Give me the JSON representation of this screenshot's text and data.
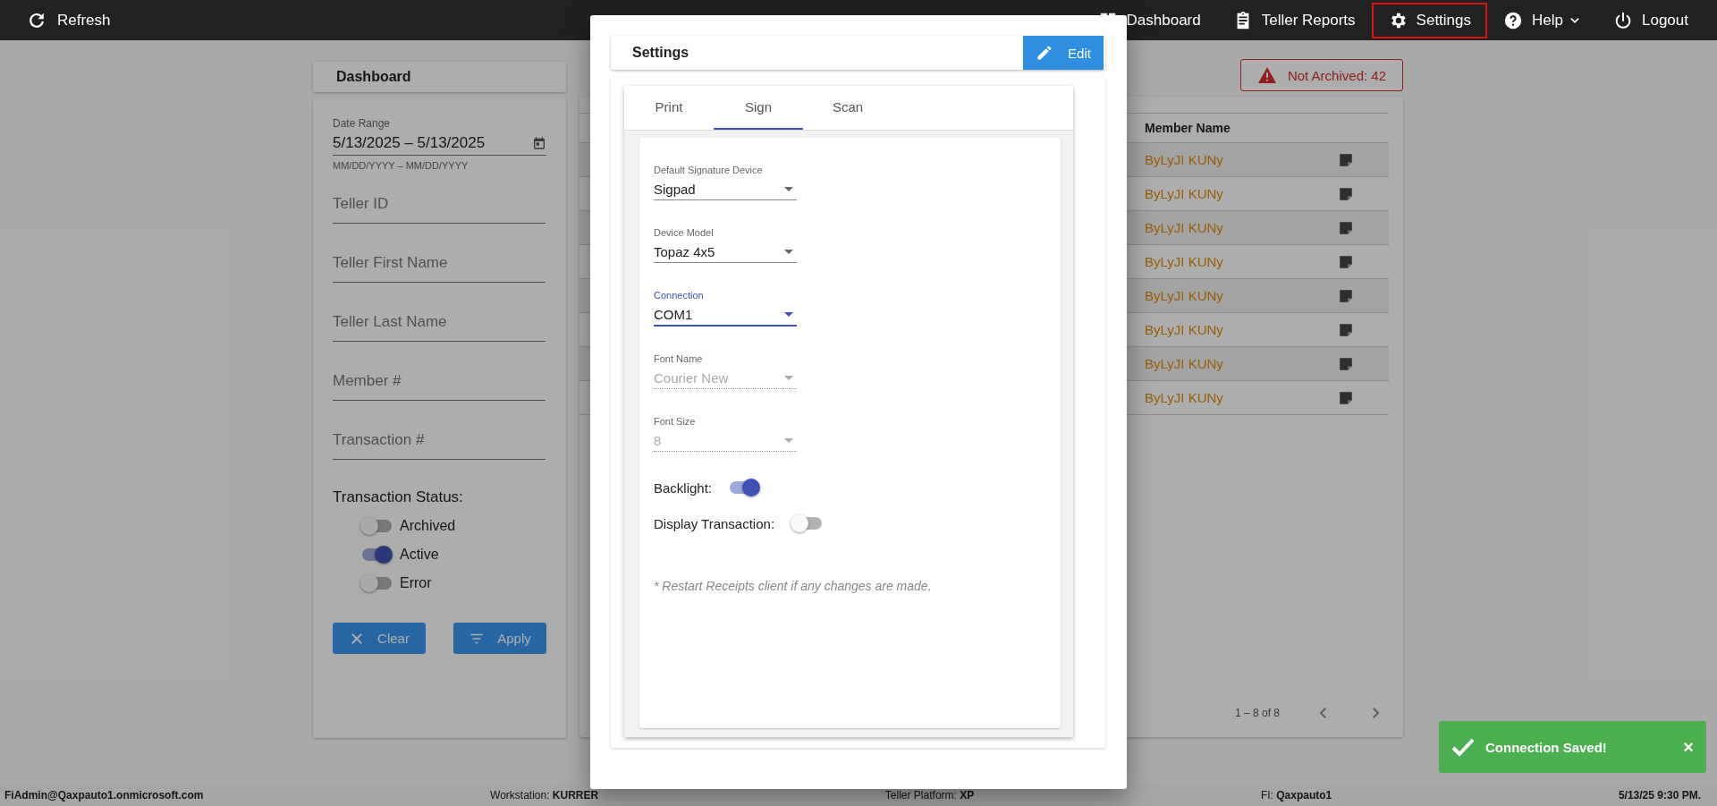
{
  "topbar": {
    "refresh": "Refresh",
    "nav": [
      {
        "kind": "dashboard",
        "label": "Dashboard",
        "selected": false
      },
      {
        "kind": "reports",
        "label": "Teller Reports",
        "selected": false
      },
      {
        "kind": "settings",
        "label": "Settings",
        "selected": true
      },
      {
        "kind": "help",
        "label": "Help",
        "selected": false
      },
      {
        "kind": "logout",
        "label": "Logout",
        "selected": false
      }
    ]
  },
  "dashboard": {
    "title": "Dashboard",
    "date_range": {
      "label": "Date Range",
      "value": "5/13/2025 – 5/13/2025",
      "hint": "MM/DD/YYYY – MM/DD/YYYY"
    },
    "fields": [
      {
        "placeholder": "Teller ID"
      },
      {
        "placeholder": "Teller First Name"
      },
      {
        "placeholder": "Teller Last Name"
      },
      {
        "placeholder": "Member #"
      },
      {
        "placeholder": "Transaction #"
      }
    ],
    "status_title": "Transaction Status:",
    "status_toggles": [
      {
        "label": "Archived",
        "on": false
      },
      {
        "label": "Active",
        "on": true
      },
      {
        "label": "Error",
        "on": false
      }
    ],
    "buttons": [
      {
        "kind": "clear",
        "label": "Clear"
      },
      {
        "kind": "apply",
        "label": "Apply"
      }
    ]
  },
  "not_archived": "Not Archived: 42",
  "table": {
    "columns": [
      "Member Name"
    ],
    "rows": [
      {
        "member_name": "ByLyJI KUNy"
      },
      {
        "member_name": "ByLyJI KUNy"
      },
      {
        "member_name": "ByLyJI KUNy"
      },
      {
        "member_name": "ByLyJI KUNy"
      },
      {
        "member_name": "ByLyJI KUNy"
      },
      {
        "member_name": "ByLyJI KUNy"
      },
      {
        "member_name": "ByLyJI KUNy"
      },
      {
        "member_name": "ByLyJI KUNy"
      }
    ],
    "pagination": "1 – 8 of 8"
  },
  "settings_dialog": {
    "title": "Settings",
    "edit": "Edit",
    "tabs": [
      {
        "label": "Print",
        "selected": false
      },
      {
        "label": "Sign",
        "selected": true
      },
      {
        "label": "Scan",
        "selected": false
      }
    ],
    "fields": [
      {
        "label": "Default Signature Device",
        "value": "Sigpad",
        "focused": false,
        "disabled": false
      },
      {
        "label": "Device Model",
        "value": "Topaz 4x5",
        "focused": false,
        "disabled": false
      },
      {
        "label": "Connection",
        "value": "COM1",
        "focused": true,
        "disabled": false
      },
      {
        "label": "Font Name",
        "value": "Courier New",
        "focused": false,
        "disabled": true
      },
      {
        "label": "Font Size",
        "value": "8",
        "focused": false,
        "disabled": true
      }
    ],
    "toggles": [
      {
        "label": "Backlight:",
        "on": true
      },
      {
        "label": "Display Transaction:",
        "on": false
      }
    ],
    "note": "* Restart Receipts client if any changes are made."
  },
  "toast": {
    "message": "Connection Saved!",
    "close": "×"
  },
  "status_bar": {
    "user": "FiAdmin@Qaxpauto1.onmicrosoft.com",
    "items": [
      {
        "label": "Workstation:",
        "value": "KURRER"
      },
      {
        "label": "Teller Platform:",
        "value": "XP"
      },
      {
        "label": "FI:",
        "value": "Qaxpauto1"
      }
    ],
    "time": "5/13/25 9:30 PM."
  }
}
